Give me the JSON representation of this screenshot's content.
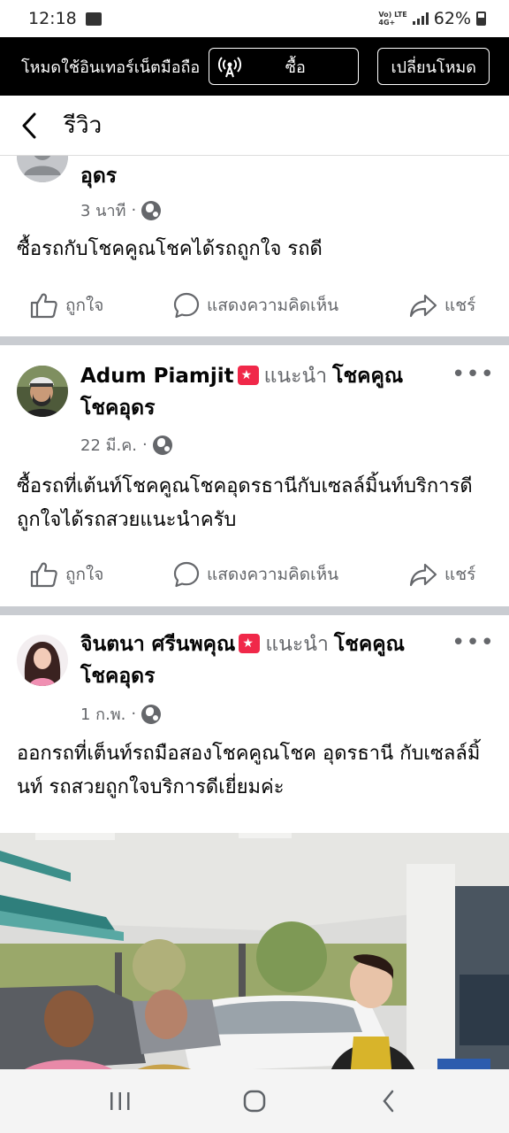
{
  "status_bar": {
    "time": "12:18",
    "net_top": "Vo) LTE",
    "net_mid": "4G+",
    "battery": "62%"
  },
  "free_mode": {
    "text": "โหมดใช้อินเทอร์เน็ตมือถือ",
    "buy_label": "ซื้อ",
    "switch_label": "เปลี่ยนโหมด"
  },
  "header": {
    "title": "รีวิว"
  },
  "posts": [
    {
      "author_tail": "อุดร",
      "time": "3 นาที",
      "text": "ซื้อรถกับโชคคูณโชคได้รถถูกใจ รถดี",
      "like": "ถูกใจ",
      "comment": "แสดงความคิดเห็น",
      "share": "แชร์"
    },
    {
      "author": "Adum Piamjit",
      "recommend": "แนะนำ",
      "page": "โชคคูณ โชคอุดร",
      "time": "22 มี.ค.",
      "text": "ซื้อรถที่เต้นท์โชคคูณโชคอุดรธานีกับเซลล์มิ้นท์บริการดีถูกใจได้รถสวยแนะนำครับ",
      "like": "ถูกใจ",
      "comment": "แสดงความคิดเห็น",
      "share": "แชร์"
    },
    {
      "author": "จินตนา ศรีนพคุณ",
      "recommend": "แนะนำ",
      "page": "โชคคูณ โชคอุดร",
      "time": "1 ก.พ.",
      "text": "ออกรถที่เต็นท์รถมือสองโชคคูณโชค อุดรธานี กับเซลล์มิ้นท์ รถสวยถูกใจบริการดีเยี่ยมค่ะ"
    }
  ],
  "icons": {
    "gallery": "gallery-icon",
    "hotspot": "hotspot-icon",
    "back": "back-arrow-icon",
    "like": "thumbs-up-icon",
    "comment": "comment-bubble-icon",
    "share": "share-arrow-icon",
    "globe": "globe-icon",
    "more": "more-dots-icon"
  },
  "colors": {
    "separator": "#c9ccd1",
    "secondary_text": "#65676b",
    "badge": "#f02849"
  }
}
